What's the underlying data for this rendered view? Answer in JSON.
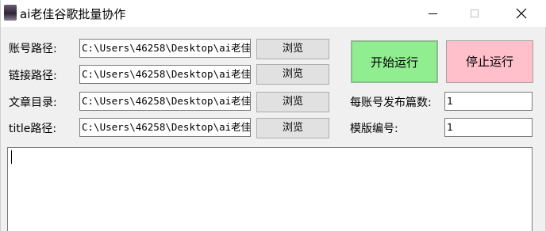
{
  "window": {
    "title": "ai老佳谷歌批量协作",
    "controls": {
      "minimize": "minimize-icon",
      "maximize": "maximize-icon",
      "close": "close-icon"
    }
  },
  "form": {
    "rows": [
      {
        "label": "账号路径:",
        "value": "C:\\Users\\46258\\Desktop\\ai老佳",
        "button": "浏览"
      },
      {
        "label": "链接路径:",
        "value": "C:\\Users\\46258\\Desktop\\ai老佳",
        "button": "浏览"
      },
      {
        "label": "文章目录:",
        "value": "C:\\Users\\46258\\Desktop\\ai老佳",
        "button": "浏览"
      },
      {
        "label": "title路径:",
        "value": "C:\\Users\\46258\\Desktop\\ai老佳",
        "button": "浏览"
      }
    ]
  },
  "actions": {
    "start_label": "开始运行",
    "stop_label": "停止运行"
  },
  "settings": {
    "posts_per_account_label": "每账号发布篇数:",
    "posts_per_account_value": "1",
    "template_number_label": "模版编号:",
    "template_number_value": "1"
  },
  "log": {
    "text": ""
  },
  "colors": {
    "start_button": "#90ee90",
    "stop_button": "#ffc0cb"
  }
}
